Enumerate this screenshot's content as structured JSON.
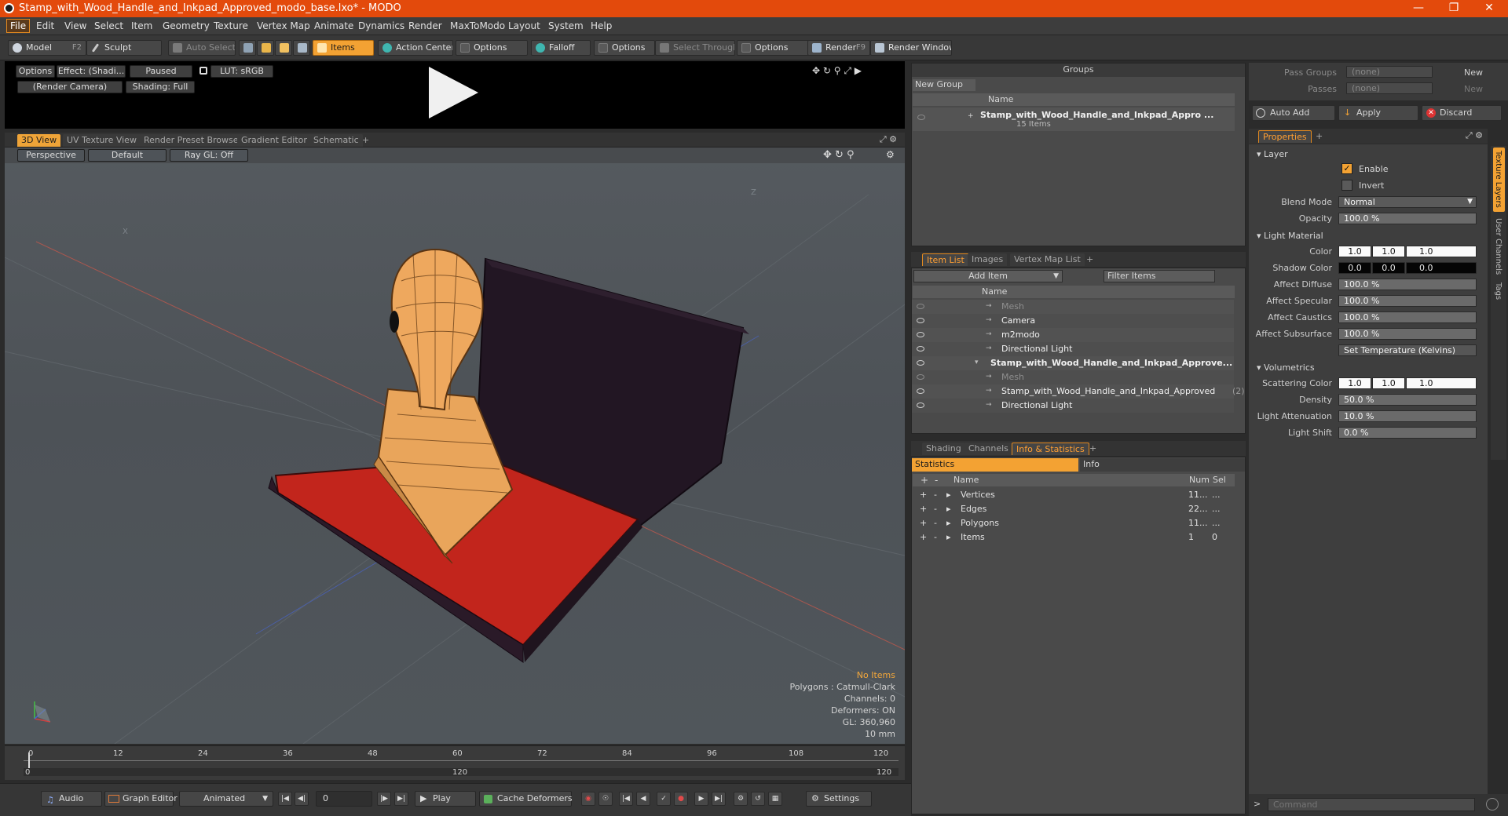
{
  "window": {
    "title": "Stamp_with_Wood_Handle_and_Inkpad_Approved_modo_base.lxo* - MODO"
  },
  "menu": [
    "File",
    "Edit",
    "View",
    "Select",
    "Item",
    "Geometry",
    "Texture",
    "Vertex Map",
    "Animate",
    "Dynamics",
    "Render",
    "MaxToModo",
    "Layout",
    "System",
    "Help"
  ],
  "toolbar": {
    "model": "Model",
    "model_key": "F2",
    "sculpt": "Sculpt",
    "auto_select": "Auto Select",
    "items": "Items",
    "action_center": "Action Center",
    "options1": "Options",
    "falloff": "Falloff",
    "options2": "Options",
    "select_through": "Select Through",
    "options3": "Options",
    "render": "Render",
    "render_key": "F9",
    "render_window": "Render Window"
  },
  "preview": {
    "options": "Options",
    "effect": "Effect: (Shadi...",
    "paused": "Paused",
    "lut": "LUT: sRGB",
    "camera": "(Render Camera)",
    "shading": "Shading: Full"
  },
  "viewtabs": [
    "3D View",
    "UV Texture View",
    "Render Preset Browser",
    "Gradient Editor",
    "Schematic",
    "+"
  ],
  "viewport": {
    "perspective": "Perspective",
    "default": "Default",
    "raygl": "Ray GL: Off",
    "axis_z": "Z",
    "axis_x": "X",
    "overlay": {
      "no_items": "No Items",
      "polygons": "Polygons : Catmull-Clark",
      "channels": "Channels: 0",
      "deformers": "Deformers: ON",
      "gl": "GL: 360,960",
      "unit": "10 mm"
    }
  },
  "timeline": {
    "ticks_top": [
      "0",
      "12",
      "24",
      "36",
      "48",
      "60",
      "72",
      "84",
      "96",
      "108",
      "120"
    ],
    "ticks_bottom_left": "0",
    "ticks_bottom_mid": "120",
    "ticks_bottom_right": "120"
  },
  "bottombar": {
    "audio": "Audio",
    "graph_editor": "Graph Editor",
    "animated": "Animated",
    "frame": "0",
    "play": "Play",
    "cache": "Cache Deformers",
    "settings": "Settings"
  },
  "groups": {
    "title": "Groups",
    "new_group": "New Group",
    "col_name": "Name",
    "item_name": "Stamp_with_Wood_Handle_and_Inkpad_Appro ...",
    "item_count": "15 Items"
  },
  "itemlist": {
    "tabs": [
      "Item List",
      "Images",
      "Vertex Map List",
      "+"
    ],
    "add_item": "Add Item",
    "filter": "Filter Items",
    "col_name": "Name",
    "rows": [
      {
        "name": "Mesh",
        "dim": true,
        "indent": 1
      },
      {
        "name": "Camera",
        "dim": false,
        "indent": 1
      },
      {
        "name": "m2modo",
        "dim": false,
        "indent": 1
      },
      {
        "name": "Directional Light",
        "dim": false,
        "indent": 1
      },
      {
        "name": "Stamp_with_Wood_Handle_and_Inkpad_Approve...",
        "dim": false,
        "indent": 0
      },
      {
        "name": "Mesh",
        "dim": true,
        "indent": 1
      },
      {
        "name": "Stamp_with_Wood_Handle_and_Inkpad_Approved",
        "count": "(2)",
        "dim": false,
        "indent": 1
      },
      {
        "name": "Directional Light",
        "dim": false,
        "indent": 1
      }
    ]
  },
  "stats": {
    "tabs": [
      "Shading",
      "Channels",
      "Info & Statistics",
      "+"
    ],
    "sub_tabs": [
      "Statistics",
      "Info"
    ],
    "cols": [
      "Name",
      "Num",
      "Sel"
    ],
    "rows": [
      {
        "name": "Vertices",
        "num": "11...",
        "sel": "..."
      },
      {
        "name": "Edges",
        "num": "22...",
        "sel": "..."
      },
      {
        "name": "Polygons",
        "num": "11...",
        "sel": "..."
      },
      {
        "name": "Items",
        "num": "1",
        "sel": "0"
      }
    ]
  },
  "passes": {
    "pass_groups": "Pass Groups",
    "passes": "Passes",
    "none": "(none)",
    "new": "New",
    "auto_add": "Auto Add",
    "apply": "Apply",
    "discard": "Discard"
  },
  "properties": {
    "tab": "Properties",
    "plus": "+",
    "layer": "Layer",
    "enable": "Enable",
    "invert": "Invert",
    "blend_mode_label": "Blend Mode",
    "blend_mode": "Normal",
    "opacity_label": "Opacity",
    "opacity": "100.0 %",
    "light_material": "Light Material",
    "color_label": "Color",
    "color": [
      "1.0",
      "1.0",
      "1.0"
    ],
    "shadow_label": "Shadow Color",
    "shadow": [
      "0.0",
      "0.0",
      "0.0"
    ],
    "diffuse_label": "Affect Diffuse",
    "diffuse": "100.0 %",
    "specular_label": "Affect Specular",
    "specular": "100.0 %",
    "caustics_label": "Affect Caustics",
    "caustics": "100.0 %",
    "subsurface_label": "Affect Subsurface",
    "subsurface": "100.0 %",
    "set_temp": "Set Temperature (Kelvins)",
    "volumetrics": "Volumetrics",
    "scatter_label": "Scattering Color",
    "scatter": [
      "1.0",
      "1.0",
      "1.0"
    ],
    "density_label": "Density",
    "density": "50.0 %",
    "atten_label": "Light Attenuation",
    "atten": "10.0 %",
    "shift_label": "Light Shift",
    "shift": "0.0 %",
    "side_tabs": [
      "Texture Layers",
      "User Channels",
      "Tags"
    ],
    "command_placeholder": "Command"
  }
}
